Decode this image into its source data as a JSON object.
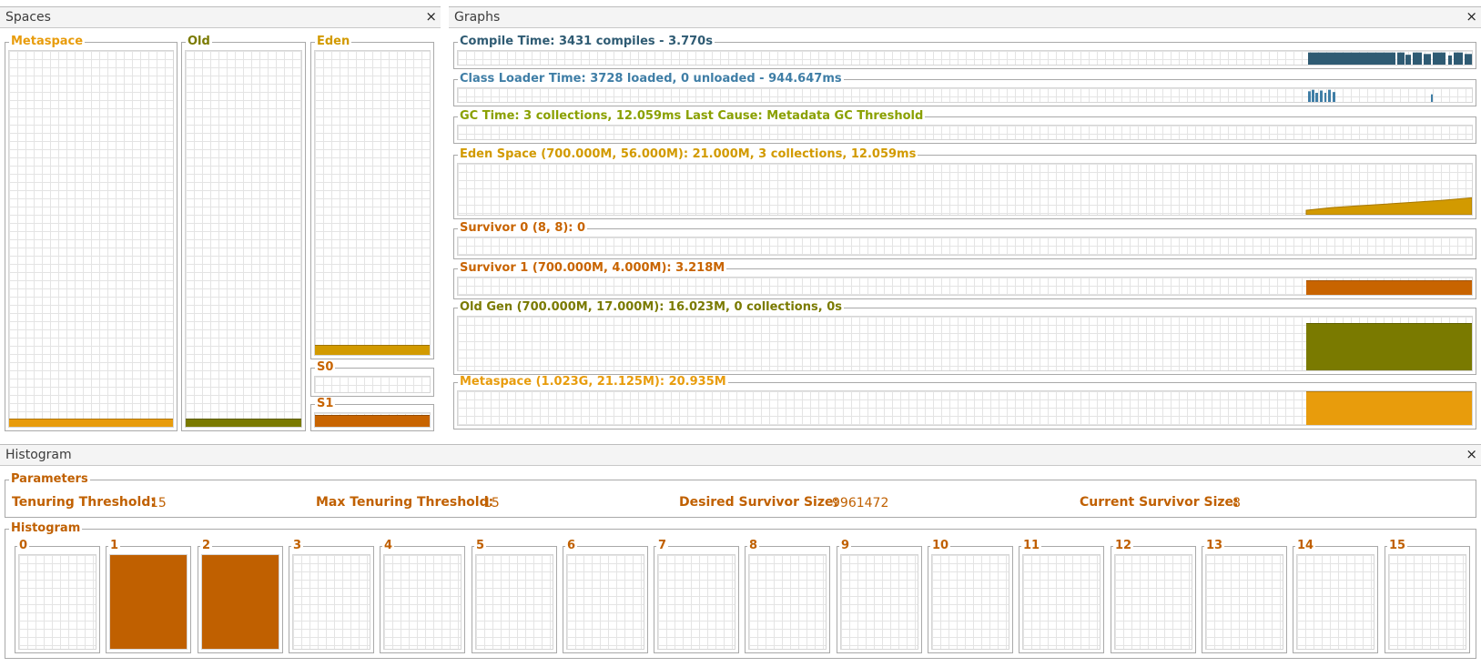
{
  "spaces": {
    "title": "Spaces",
    "close_label": "×",
    "metaspace": {
      "label": "Metaspace",
      "color": "#e89c0c",
      "level": 0.02
    },
    "old": {
      "label": "Old",
      "color": "#7a7a00",
      "level": 0.02
    },
    "eden": {
      "label": "Eden",
      "color": "#d29a00",
      "level": 0.03
    },
    "s0": {
      "label": "S0",
      "color": "#c86400",
      "level": 0.0
    },
    "s1": {
      "label": "S1",
      "color": "#c86400",
      "level": 0.8
    }
  },
  "graphs": {
    "title": "Graphs",
    "close_label": "×",
    "rows": [
      {
        "id": "compile-time",
        "label": "Compile Time: 3431 compiles - 3.770s",
        "color": "#2f5b73"
      },
      {
        "id": "class-loader-time",
        "label": "Class Loader Time: 3728 loaded, 0 unloaded - 944.647ms",
        "color": "#3f7ea6"
      },
      {
        "id": "gc-time",
        "label": "GC Time: 3 collections, 12.059ms Last Cause: Metadata GC Threshold",
        "color": "#8aa000"
      },
      {
        "id": "eden-space",
        "label": "Eden Space (700.000M, 56.000M): 21.000M, 3 collections, 12.059ms",
        "color": "#d29a00"
      },
      {
        "id": "survivor-0",
        "label": "Survivor 0 (8, 8): 0",
        "color": "#c86400"
      },
      {
        "id": "survivor-1",
        "label": "Survivor 1 (700.000M, 4.000M): 3.218M",
        "color": "#c86400"
      },
      {
        "id": "old-gen",
        "label": "Old Gen (700.000M, 17.000M): 16.023M, 0 collections, 0s",
        "color": "#7a7a00"
      },
      {
        "id": "metaspace",
        "label": "Metaspace (1.023G, 21.125M): 20.935M",
        "color": "#e89c0c"
      }
    ]
  },
  "histogram_panel": {
    "title": "Histogram",
    "close_label": "×",
    "parameters": {
      "legend": "Parameters",
      "tenuring_threshold_label": "Tenuring Threshold:",
      "tenuring_threshold_value": "15",
      "max_tenuring_threshold_label": "Max Tenuring Threshold:",
      "max_tenuring_threshold_value": "15",
      "desired_survivor_size_label": "Desired Survivor Size:",
      "desired_survivor_size_value": "9961472",
      "current_survivor_size_label": "Current Survivor Size:",
      "current_survivor_size_value": "8"
    },
    "histogram": {
      "legend": "Histogram",
      "color": "#c06000",
      "buckets": [
        {
          "label": "0",
          "level": 0
        },
        {
          "label": "1",
          "level": 1
        },
        {
          "label": "2",
          "level": 1
        },
        {
          "label": "3",
          "level": 0
        },
        {
          "label": "4",
          "level": 0
        },
        {
          "label": "5",
          "level": 0
        },
        {
          "label": "6",
          "level": 0
        },
        {
          "label": "7",
          "level": 0
        },
        {
          "label": "8",
          "level": 0
        },
        {
          "label": "9",
          "level": 0
        },
        {
          "label": "10",
          "level": 0
        },
        {
          "label": "11",
          "level": 0
        },
        {
          "label": "12",
          "level": 0
        },
        {
          "label": "13",
          "level": 0
        },
        {
          "label": "14",
          "level": 0
        },
        {
          "label": "15",
          "level": 0
        }
      ]
    }
  }
}
